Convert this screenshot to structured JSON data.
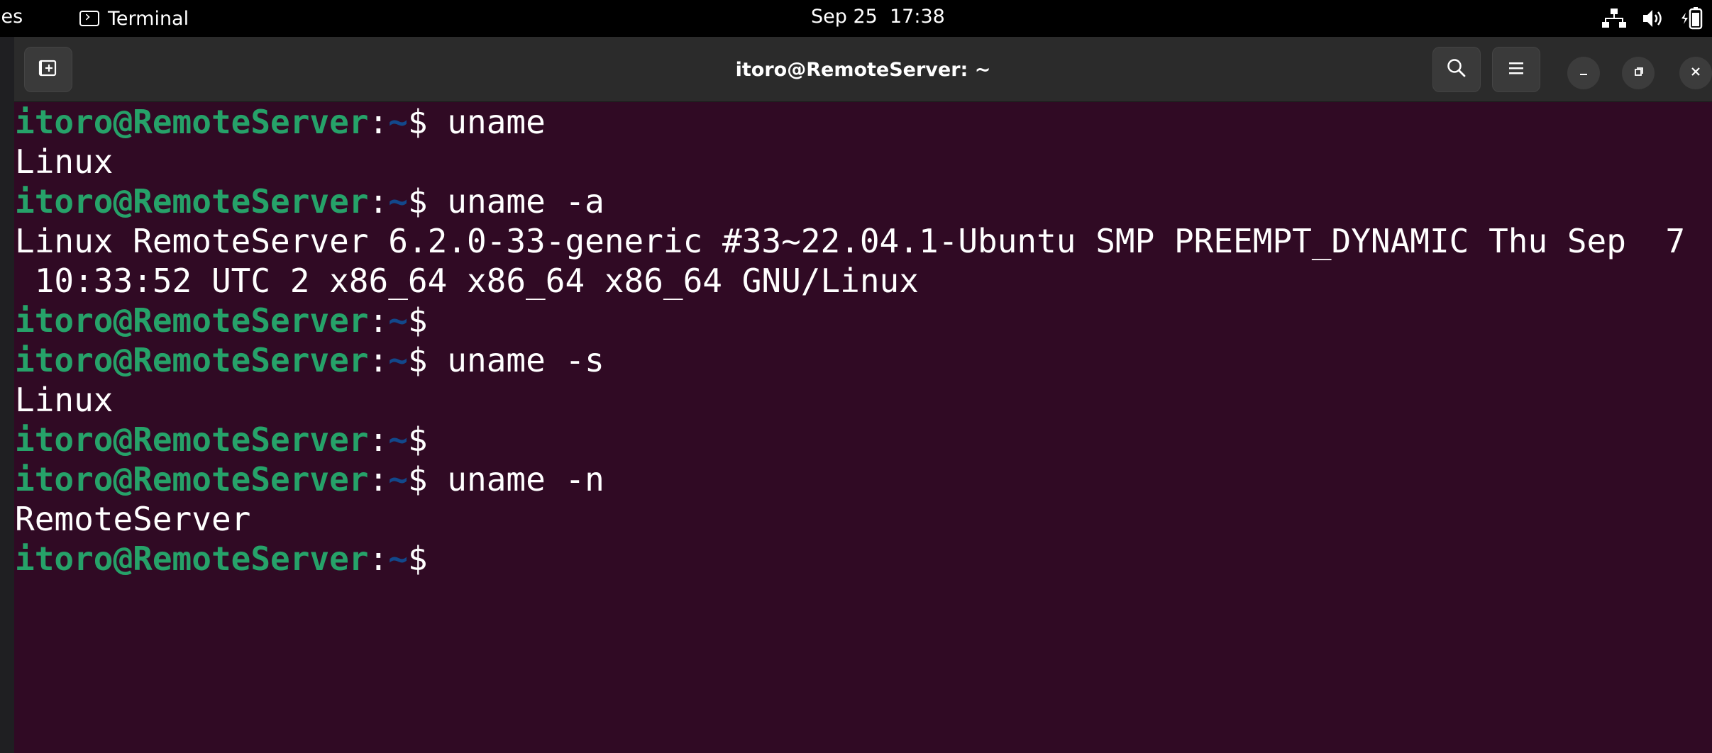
{
  "topbar": {
    "activities": "ies",
    "app_name": "Terminal",
    "app_icon": "terminal-icon",
    "clock": "Sep 25  17:38",
    "status_icons": [
      "network-icon",
      "volume-icon",
      "battery-icon"
    ]
  },
  "window": {
    "title": "itoro@RemoteServer: ~",
    "buttons": {
      "new_tab_icon": "new-tab-icon",
      "search_icon": "search-icon",
      "menu_icon": "hamburger-menu-icon",
      "minimize_icon": "minimize-icon",
      "maximize_icon": "maximize-icon",
      "close_icon": "close-icon"
    }
  },
  "colors": {
    "terminal_bg": "#300a24",
    "prompt_user": "#26a269",
    "prompt_path": "#12488b",
    "text": "#ffffff"
  },
  "prompt": {
    "user_host": "itoro@RemoteServer",
    "colon": ":",
    "path": "~",
    "dollar": "$"
  },
  "lines": [
    {
      "type": "prompt",
      "command": " uname"
    },
    {
      "type": "output",
      "text": "Linux"
    },
    {
      "type": "prompt",
      "command": " uname -a"
    },
    {
      "type": "output",
      "text": "Linux RemoteServer 6.2.0-33-generic #33~22.04.1-Ubuntu SMP PREEMPT_DYNAMIC Thu Sep  7"
    },
    {
      "type": "output",
      "text": " 10:33:52 UTC 2 x86_64 x86_64 x86_64 GNU/Linux"
    },
    {
      "type": "prompt",
      "command": ""
    },
    {
      "type": "prompt",
      "command": " uname -s"
    },
    {
      "type": "output",
      "text": "Linux"
    },
    {
      "type": "prompt",
      "command": ""
    },
    {
      "type": "prompt",
      "command": " uname -n"
    },
    {
      "type": "output",
      "text": "RemoteServer"
    },
    {
      "type": "prompt",
      "command": ""
    }
  ]
}
